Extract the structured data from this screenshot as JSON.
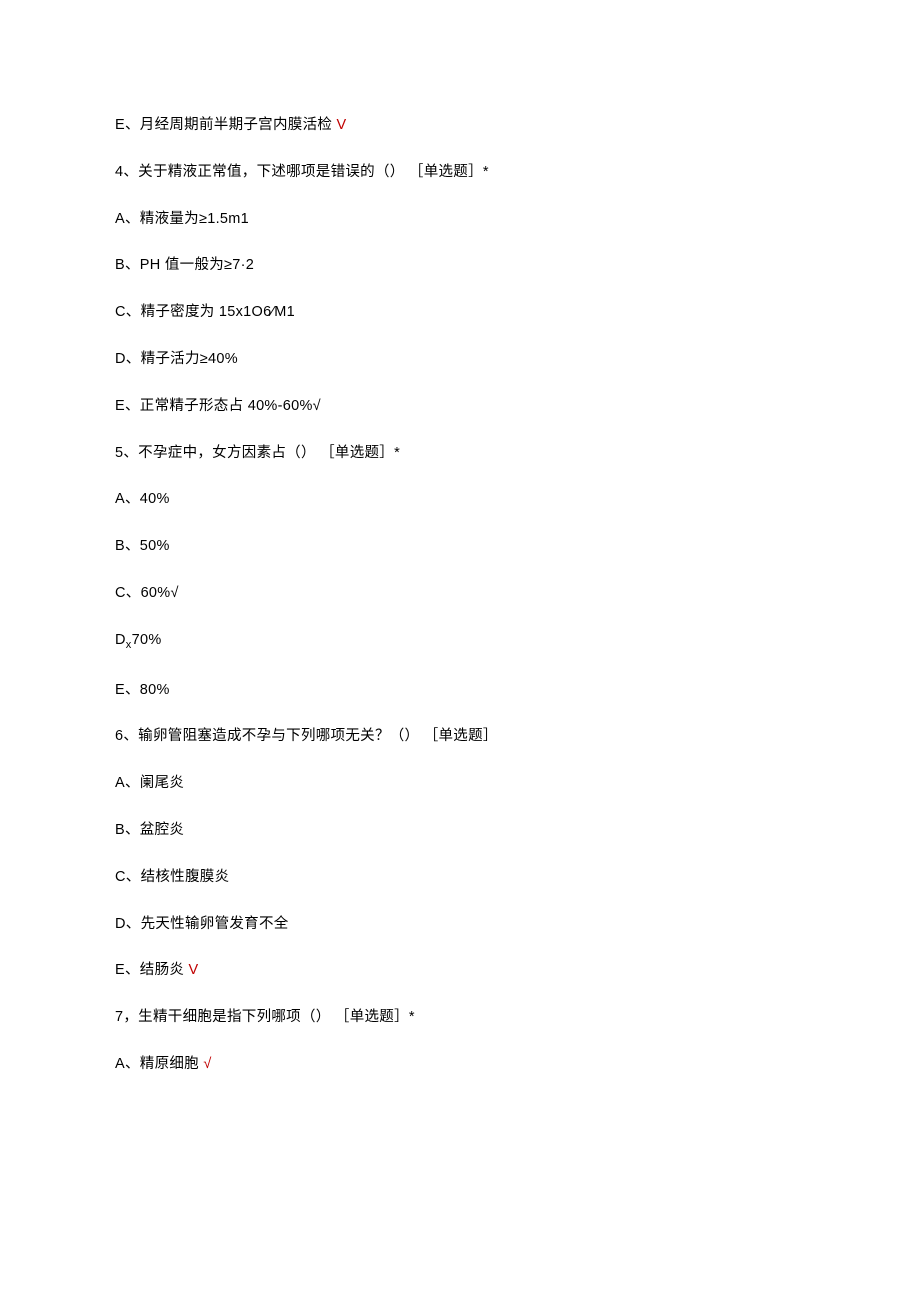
{
  "lines": [
    {
      "pre": "E、月经周期前半期子宫内膜活检 ",
      "mark": "V",
      "post": ""
    },
    {
      "pre": "4、关于精液正常值，下述哪项是错误的（） ［单选题］*",
      "mark": "",
      "post": ""
    },
    {
      "pre": "A、精液量为≥1.5m1",
      "mark": "",
      "post": ""
    },
    {
      "pre": "B、PH 值一般为≥7·2",
      "mark": "",
      "post": ""
    },
    {
      "pre": "C、精子密度为 15x1O6⁄M1",
      "mark": "",
      "post": ""
    },
    {
      "pre": "D、精子活力≥40%",
      "mark": "",
      "post": ""
    },
    {
      "pre": "E、正常精子形态占 40%-60%√",
      "mark": "",
      "post": ""
    },
    {
      "pre": "5、不孕症中，女方因素占（） ［单选题］*",
      "mark": "",
      "post": ""
    },
    {
      "pre": "A、40%",
      "mark": "",
      "post": ""
    },
    {
      "pre": "B、50%",
      "mark": "",
      "post": ""
    },
    {
      "pre": "C、60%√",
      "mark": "",
      "post": ""
    },
    {
      "pre": "",
      "mark": "",
      "post": "",
      "special": "dx70"
    },
    {
      "pre": "E、80%",
      "mark": "",
      "post": ""
    },
    {
      "pre": "6、输卵管阻塞造成不孕与下列哪项无关？（） ［单选题］",
      "mark": "",
      "post": ""
    },
    {
      "pre": "A、阑尾炎",
      "mark": "",
      "post": ""
    },
    {
      "pre": "B、盆腔炎",
      "mark": "",
      "post": ""
    },
    {
      "pre": "C、结核性腹膜炎",
      "mark": "",
      "post": ""
    },
    {
      "pre": "D、先天性输卵管发育不全",
      "mark": "",
      "post": ""
    },
    {
      "pre": "E、结肠炎 ",
      "mark": "V",
      "post": ""
    },
    {
      "pre": "7，生精干细胞是指下列哪项（） ［单选题］*",
      "mark": "",
      "post": ""
    },
    {
      "pre": "A、精原细胞 ",
      "mark": "√",
      "post": ""
    }
  ],
  "dx70_text": {
    "d": "D",
    "x": "x",
    "rest": "70%"
  }
}
